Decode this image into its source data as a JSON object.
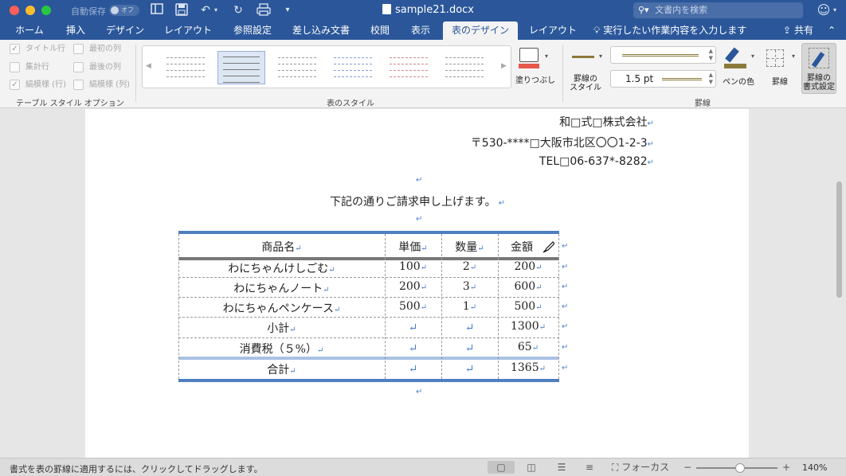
{
  "window": {
    "autosave_label": "自動保存",
    "autosave_state": "オフ",
    "document_title": "sample21.docx",
    "search_placeholder": "文書内を検索"
  },
  "tabs": [
    {
      "label": "ホーム"
    },
    {
      "label": "挿入"
    },
    {
      "label": "デザイン"
    },
    {
      "label": "レイアウト"
    },
    {
      "label": "参照設定"
    },
    {
      "label": "差し込み文書"
    },
    {
      "label": "校閲"
    },
    {
      "label": "表示"
    },
    {
      "label": "表のデザイン",
      "active": true
    },
    {
      "label": "レイアウト"
    }
  ],
  "tellme": "実行したい作業内容を入力します",
  "share": "共有",
  "ribbon": {
    "style_options": {
      "title": "テーブル スタイル オプション",
      "items": [
        {
          "label": "タイトル行",
          "checked": true
        },
        {
          "label": "最初の列",
          "checked": false
        },
        {
          "label": "集計行",
          "checked": false
        },
        {
          "label": "最後の列",
          "checked": false
        },
        {
          "label": "縞模様 (行)",
          "checked": true
        },
        {
          "label": "縞模様 (列)",
          "checked": false
        }
      ]
    },
    "table_styles": {
      "title": "表のスタイル",
      "shading_label": "塗りつぶし"
    },
    "borders": {
      "title": "罫線",
      "border_style_label": "罫線の\nスタイル",
      "weight_value": "1.5 pt",
      "pen_color_label": "ペンの色",
      "borders_label": "罫線",
      "painter_label": "罫線の\n書式設定"
    },
    "colors": {
      "shading": "#e8584a",
      "pen": "#8c7a3b",
      "accent": "#2b579a"
    }
  },
  "document": {
    "sender_lines": [
      "和□式□株式会社",
      "〒530-****□大阪市北区〇〇1-2-3",
      "TEL□06-637*-8282"
    ],
    "intro": "下記の通りご請求申し上げます。",
    "table": {
      "headers": [
        "商品名",
        "単価",
        "数量",
        "金額"
      ],
      "rows": [
        [
          "わにちゃんけしごむ",
          "100",
          "2",
          "200"
        ],
        [
          "わにちゃんノート",
          "200",
          "3",
          "600"
        ],
        [
          "わにちゃんペンケース",
          "500",
          "1",
          "500"
        ],
        [
          "小計",
          "",
          "",
          "1300"
        ],
        [
          "消費税（５%）",
          "",
          "",
          "65"
        ],
        [
          "合計",
          "",
          "",
          "1365"
        ]
      ]
    }
  },
  "statusbar": {
    "message": "書式を表の罫線に適用するには、クリックしてドラッグします。",
    "focus_label": "フォーカス",
    "zoom": "140%"
  }
}
